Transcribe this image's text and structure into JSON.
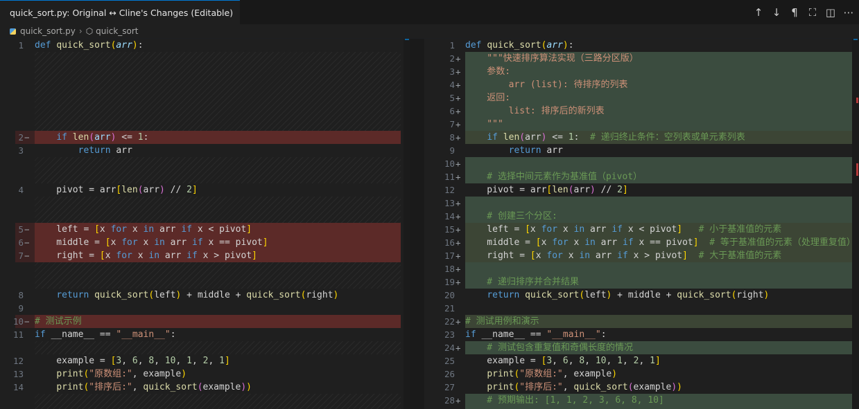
{
  "tab": {
    "title": "quick_sort.py: Original ↔ Cline's Changes (Editable)"
  },
  "toolbar": {
    "prev": "↑",
    "next": "↓",
    "whitespace": "¶",
    "map": "⛶",
    "split": "◫",
    "more": "⋯"
  },
  "breadcrumb": {
    "file": "quick_sort.py",
    "symbol": "quick_sort"
  },
  "left": {
    "lines": [
      {
        "n": "1",
        "t": "def quick_sort(arr):"
      },
      {
        "n": "2",
        "t": "    if len(arr) <= 1:"
      },
      {
        "n": "3",
        "t": "        return arr"
      },
      {
        "n": "4",
        "t": "    pivot = arr[len(arr) // 2]"
      },
      {
        "n": "5",
        "t": "    left = [x for x in arr if x < pivot]"
      },
      {
        "n": "6",
        "t": "    middle = [x for x in arr if x == pivot]"
      },
      {
        "n": "7",
        "t": "    right = [x for x in arr if x > pivot]"
      },
      {
        "n": "8",
        "t": "    return quick_sort(left) + middle + quick_sort(right)"
      },
      {
        "n": "9",
        "t": ""
      },
      {
        "n": "10",
        "t": "# 测试示例"
      },
      {
        "n": "11",
        "t": "if __name__ == \"__main__\":"
      },
      {
        "n": "12",
        "t": "    example = [3, 6, 8, 10, 1, 2, 1]"
      },
      {
        "n": "13",
        "t": "    print(\"原数组:\", example)"
      },
      {
        "n": "14",
        "t": "    print(\"排序后:\", quick_sort(example))"
      }
    ]
  },
  "right": {
    "lines": [
      {
        "n": "1",
        "t": "def quick_sort(arr):"
      },
      {
        "n": "2",
        "t": "    \"\"\"快速排序算法实现（三路分区版）"
      },
      {
        "n": "3",
        "t": "    参数:"
      },
      {
        "n": "4",
        "t": "        arr (list): 待排序的列表"
      },
      {
        "n": "5",
        "t": "    返回:"
      },
      {
        "n": "6",
        "t": "        list: 排序后的新列表"
      },
      {
        "n": "7",
        "t": "    \"\"\""
      },
      {
        "n": "8",
        "t": "    if len(arr) <= 1:  # 递归终止条件：空列表或单元素列表"
      },
      {
        "n": "9",
        "t": "        return arr"
      },
      {
        "n": "10",
        "t": ""
      },
      {
        "n": "11",
        "t": "    # 选择中间元素作为基准值（pivot）"
      },
      {
        "n": "12",
        "t": "    pivot = arr[len(arr) // 2]"
      },
      {
        "n": "13",
        "t": ""
      },
      {
        "n": "14",
        "t": "    # 创建三个分区:"
      },
      {
        "n": "15",
        "t": "    left = [x for x in arr if x < pivot]   # 小于基准值的元素"
      },
      {
        "n": "16",
        "t": "    middle = [x for x in arr if x == pivot]  # 等于基准值的元素（处理重复值）"
      },
      {
        "n": "17",
        "t": "    right = [x for x in arr if x > pivot]  # 大于基准值的元素"
      },
      {
        "n": "18",
        "t": ""
      },
      {
        "n": "19",
        "t": "    # 递归排序并合并结果"
      },
      {
        "n": "20",
        "t": "    return quick_sort(left) + middle + quick_sort(right)"
      },
      {
        "n": "21",
        "t": ""
      },
      {
        "n": "22",
        "t": "# 测试用例和演示"
      },
      {
        "n": "23",
        "t": "if __name__ == \"__main__\":"
      },
      {
        "n": "24",
        "t": "    # 测试包含重复值和奇偶长度的情况"
      },
      {
        "n": "25",
        "t": "    example = [3, 6, 8, 10, 1, 2, 1]"
      },
      {
        "n": "26",
        "t": "    print(\"原数组:\", example)"
      },
      {
        "n": "27",
        "t": "    print(\"排序后:\", quick_sort(example))"
      },
      {
        "n": "28",
        "t": "    # 预期输出: [1, 1, 2, 3, 6, 8, 10]"
      }
    ]
  }
}
